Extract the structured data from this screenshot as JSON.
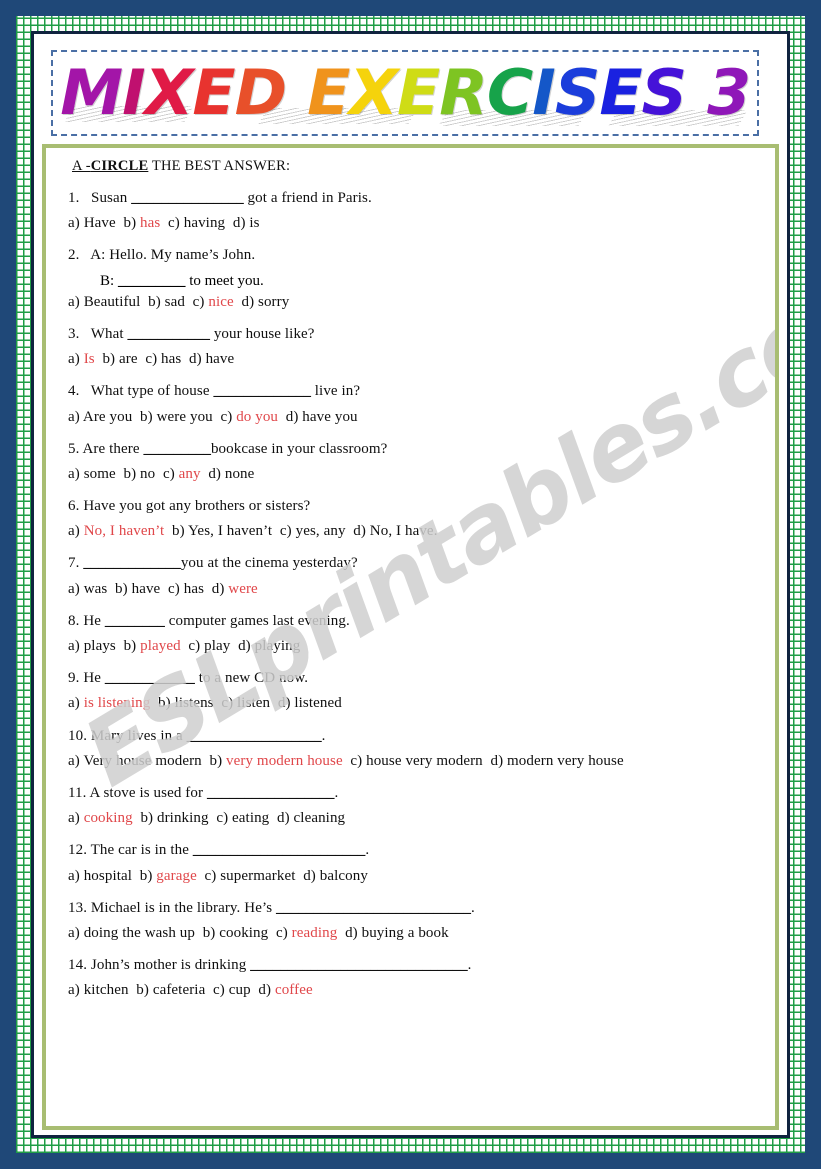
{
  "worksheet": {
    "title_letters": [
      {
        "ch": "M",
        "color": "#a315a8"
      },
      {
        "ch": "I",
        "color": "#c0106f"
      },
      {
        "ch": "X",
        "color": "#e01a46"
      },
      {
        "ch": "E",
        "color": "#e8332f"
      },
      {
        "ch": "D",
        "color": "#e8502a"
      },
      {
        "ch": " ",
        "color": "#ffffff"
      },
      {
        "ch": "E",
        "color": "#f0931c"
      },
      {
        "ch": "X",
        "color": "#f5d30c"
      },
      {
        "ch": "E",
        "color": "#cfdc16"
      },
      {
        "ch": "R",
        "color": "#7ec422"
      },
      {
        "ch": "C",
        "color": "#17a34a"
      },
      {
        "ch": "I",
        "color": "#1457c8"
      },
      {
        "ch": "S",
        "color": "#1b3ddb"
      },
      {
        "ch": "E",
        "color": "#1a21e0"
      },
      {
        "ch": "S",
        "color": "#4512d8"
      },
      {
        "ch": " ",
        "color": "#ffffff"
      },
      {
        "ch": "3",
        "color": "#8f17b8"
      }
    ],
    "title_plain": "MIXED EXERCISES 3",
    "watermark": "ESLprintables.com",
    "section_heading": {
      "prefix": "A -",
      "keyword": "CIRCLE",
      "suffix": " THE BEST ANSWER:"
    },
    "items": [
      {
        "number": "1.",
        "question": "Susan _______________ got a friend in Paris.",
        "question_pre": "Susan ",
        "blank": "_______________",
        "question_post": " got a friend in Paris.",
        "options_raw": "a) Have   b) has   c) having  d) is",
        "options": [
          {
            "label": "a)",
            "text": "Have",
            "correct": false
          },
          {
            "label": "b)",
            "text": "has",
            "correct": true
          },
          {
            "label": "c)",
            "text": "having",
            "correct": false
          },
          {
            "label": "d)",
            "text": "is",
            "correct": false
          }
        ]
      },
      {
        "number": "2.",
        "question_line_a": "A: Hello. My name’s John.",
        "question_line_b_pre": "B: ",
        "blank": "_________",
        "question_line_b_post": " to meet you.",
        "options_raw": "a)Beautiful  b) sad c) nice  d) sorry",
        "options": [
          {
            "label": "a)",
            "text": "Beautiful",
            "correct": false
          },
          {
            "label": "b)",
            "text": "sad",
            "correct": false
          },
          {
            "label": "c)",
            "text": "nice",
            "correct": true
          },
          {
            "label": "d)",
            "text": "sorry",
            "correct": false
          }
        ]
      },
      {
        "number": "3.",
        "question_pre": "What ",
        "blank": "___________",
        "question_post": " your house like?",
        "options_raw": "a)Is  b) are  c) has  d) have",
        "options": [
          {
            "label": "a)",
            "text": "Is",
            "correct": true
          },
          {
            "label": "b)",
            "text": "are",
            "correct": false
          },
          {
            "label": "c)",
            "text": "has",
            "correct": false
          },
          {
            "label": "d)",
            "text": "have",
            "correct": false
          }
        ]
      },
      {
        "number": "4.",
        "question_pre": "What type of house  ",
        "blank": "_____________",
        "question_post": " live in?",
        "options_raw": "a)   Are you b) were you c) do you d) have you",
        "options": [
          {
            "label": "a)",
            "text": "Are you",
            "correct": false
          },
          {
            "label": "b)",
            "text": "were you",
            "correct": false
          },
          {
            "label": "c)",
            "text": "do you",
            "correct": true
          },
          {
            "label": "d)",
            "text": "have you",
            "correct": false
          }
        ]
      },
      {
        "number": "5.",
        "question_pre": "Are there ",
        "blank": "_________",
        "question_post": "bookcase in your classroom?",
        "options_raw": " a) some b) no c) any d) none",
        "options": [
          {
            "label": "a)",
            "text": "some",
            "correct": false
          },
          {
            "label": "b)",
            "text": "no",
            "correct": false
          },
          {
            "label": "c)",
            "text": "any",
            "correct": true
          },
          {
            "label": "d)",
            "text": "none",
            "correct": false
          }
        ]
      },
      {
        "number": "6.",
        "question_pre": "Have you got any brothers or sisters?",
        "blank": "",
        "question_post": "",
        "options_raw": "a) No, I haven’t b) Yes, I haven’t c) yes, any d) No, I have.",
        "options": [
          {
            "label": "a)",
            "text": "No, I haven’t",
            "correct": true
          },
          {
            "label": "b)",
            "text": "Yes, I haven’t",
            "correct": false
          },
          {
            "label": "c)",
            "text": "yes, any",
            "correct": false
          },
          {
            "label": "d)",
            "text": "No, I have.",
            "correct": false
          }
        ]
      },
      {
        "number": "7.",
        "question_pre": " ",
        "blank": "_____________",
        "question_post": "you at the cinema yesterday?",
        "options_raw": "a) was b) have c) has d) were",
        "options": [
          {
            "label": "a)",
            "text": "was",
            "correct": false
          },
          {
            "label": "b)",
            "text": "have",
            "correct": false
          },
          {
            "label": "c)",
            "text": "has",
            "correct": false
          },
          {
            "label": "d)",
            "text": "were",
            "correct": true
          }
        ]
      },
      {
        "number": "8.",
        "question_pre": "He ",
        "blank": "________",
        "question_post": " computer games last evening.",
        "options_raw": "a) plays b) played c) play d) playing",
        "options": [
          {
            "label": "a)",
            "text": "plays",
            "correct": false
          },
          {
            "label": "b)",
            "text": "played",
            "correct": true
          },
          {
            "label": "c)",
            "text": "play",
            "correct": false
          },
          {
            "label": "d)",
            "text": "playing",
            "correct": false
          }
        ]
      },
      {
        "number": "9.",
        "question_pre": "He ",
        "blank": "____________",
        "question_post": " to a new CD now.",
        "options_raw": "a) is listening b) listens  c) listen  d) listened",
        "options": [
          {
            "label": "a)",
            "text": "is listening",
            "correct": true
          },
          {
            "label": "b)",
            "text": "listens",
            "correct": false
          },
          {
            "label": "c)",
            "text": "listen",
            "correct": false
          },
          {
            "label": "d)",
            "text": "listened",
            "correct": false
          }
        ]
      },
      {
        "number": "10.",
        "question_pre": "Mary lives in a ",
        "blank": "__________________",
        "question_post": ".",
        "options_raw": "a) Very house modern b) very modern house c) house very modern d) modern very house",
        "options": [
          {
            "label": "a)",
            "text": "Very house modern",
            "correct": false
          },
          {
            "label": "b)",
            "text": "very modern house",
            "correct": true
          },
          {
            "label": "c)",
            "text": "house very modern",
            "correct": false
          },
          {
            "label": "d)",
            "text": "modern very house",
            "correct": false
          }
        ]
      },
      {
        "number": "11.",
        "question_pre": "A stove is used for ",
        "blank": "_________________",
        "question_post": ".",
        "options_raw": "a) cooking b) drinking c) eating d) cleaning",
        "options": [
          {
            "label": "a)",
            "text": "cooking",
            "correct": true
          },
          {
            "label": "b)",
            "text": "drinking",
            "correct": false
          },
          {
            "label": "c)",
            "text": "eating",
            "correct": false
          },
          {
            "label": "d)",
            "text": "cleaning",
            "correct": false
          }
        ]
      },
      {
        "number": "12.",
        "question_pre": "The car is in the ",
        "blank": "_______________________",
        "question_post": ".",
        "options_raw": "a)hospital b) garage c) supermarket d) balcony",
        "options": [
          {
            "label": "a)",
            "text": "hospital",
            "correct": false
          },
          {
            "label": "b)",
            "text": "garage",
            "correct": true
          },
          {
            "label": "c)",
            "text": "supermarket",
            "correct": false
          },
          {
            "label": "d)",
            "text": "balcony",
            "correct": false
          }
        ]
      },
      {
        "number": "13.",
        "question_pre": "Michael is in the library. He’s ",
        "blank": "__________________________",
        "question_post": ".",
        "options_raw": "a) doing the wash up b) cooking c) reading d) buying a book",
        "options": [
          {
            "label": "a)",
            "text": "doing the wash up",
            "correct": false
          },
          {
            "label": "b)",
            "text": "cooking",
            "correct": false
          },
          {
            "label": "c)",
            "text": "reading",
            "correct": true
          },
          {
            "label": "d)",
            "text": "buying a book",
            "correct": false
          }
        ]
      },
      {
        "number": "14.",
        "question_pre": "John’s mother is drinking ",
        "blank": "_____________________________",
        "question_post": ".",
        "options_raw": "a) kitchen b) cafeteria c) cup d) coffee",
        "options": [
          {
            "label": "a)",
            "text": "kitchen",
            "correct": false
          },
          {
            "label": "b)",
            "text": "cafeteria",
            "correct": false
          },
          {
            "label": "c)",
            "text": "cup",
            "correct": false
          },
          {
            "label": "d)",
            "text": "coffee",
            "correct": true
          }
        ]
      }
    ]
  },
  "colors": {
    "page_background": "#1f4878",
    "frame_green": "#1f9d46",
    "frame_navy": "#10233f",
    "content_border": "#a8bd72",
    "answer_red": "#e0474a",
    "watermark_grey": "#cfcfcf",
    "title_dash_border": "#4a6fa5"
  }
}
